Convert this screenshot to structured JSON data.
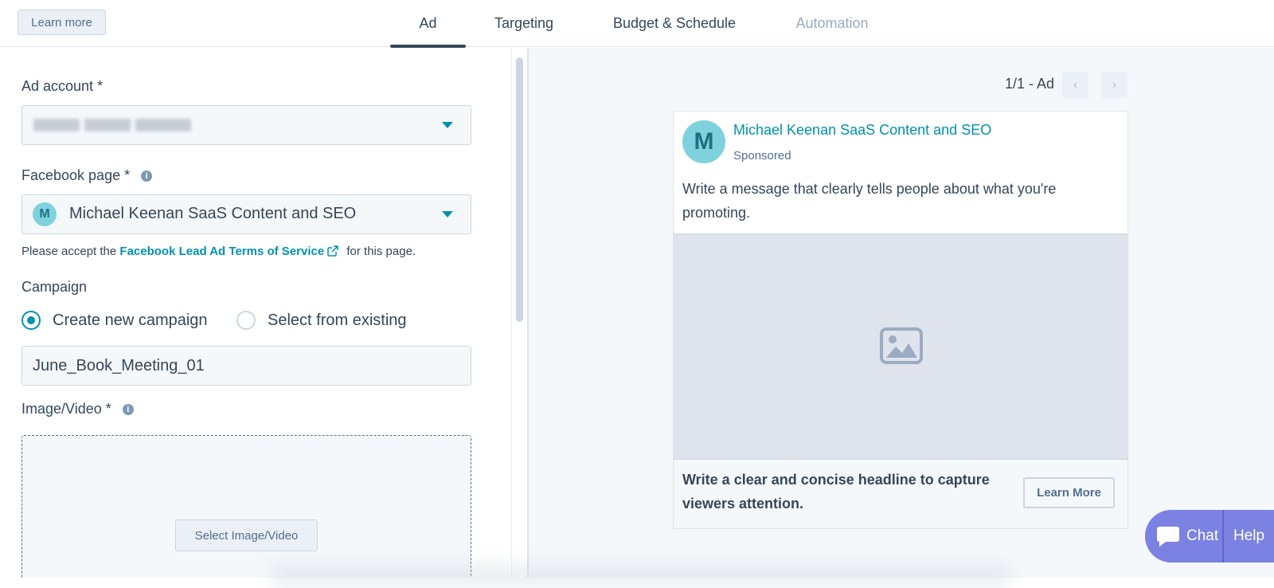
{
  "header": {
    "learn_more": "Learn more",
    "tabs": [
      {
        "label": "Ad",
        "active": true
      },
      {
        "label": "Targeting",
        "active": false
      },
      {
        "label": "Budget & Schedule",
        "active": false
      },
      {
        "label": "Automation",
        "active": false,
        "disabled": true
      }
    ]
  },
  "form": {
    "ad_account_label": "Ad account *",
    "facebook_page_label": "Facebook page *",
    "facebook_page_value": "Michael Keenan SaaS Content and SEO",
    "facebook_page_avatar": "M",
    "terms_prefix": "Please accept the ",
    "terms_link": "Facebook Lead Ad Terms of Service",
    "terms_suffix": " for this page.",
    "campaign_label": "Campaign",
    "radio_new": "Create new campaign",
    "radio_existing": "Select from existing",
    "campaign_name": "June_Book_Meeting_01",
    "media_label": "Image/Video *",
    "select_media": "Select Image/Video"
  },
  "preview": {
    "pager": "1/1 - Ad",
    "prev_icon": "‹",
    "next_icon": "›",
    "avatar": "M",
    "page_name": "Michael Keenan SaaS Content and SEO",
    "sponsored": "Sponsored",
    "message": "Write a message that clearly tells people about what you're promoting.",
    "headline": "Write a clear and concise headline to capture viewers attention.",
    "cta": "Learn More"
  },
  "widget": {
    "chat": "Chat",
    "help": "Help"
  },
  "colors": {
    "accent": "#0091ae",
    "text": "#33475b",
    "chat_bg": "#7b82e1"
  }
}
